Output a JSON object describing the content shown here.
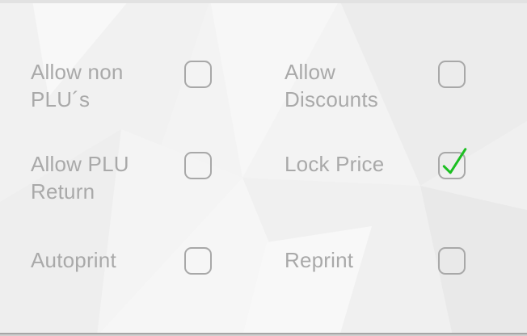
{
  "options": [
    {
      "label": "Allow non\nPLU´s",
      "checked": false
    },
    {
      "label": "Allow\nDiscounts",
      "checked": false
    },
    {
      "label": "Allow PLU\nReturn",
      "checked": false
    },
    {
      "label": "Lock Price",
      "checked": true
    },
    {
      "label": "Autoprint",
      "checked": false
    },
    {
      "label": "Reprint",
      "checked": false
    }
  ],
  "colors": {
    "label": "#a9a9a9",
    "checkbox_border": "#a8a8a8",
    "check_mark": "#1bbf21"
  }
}
